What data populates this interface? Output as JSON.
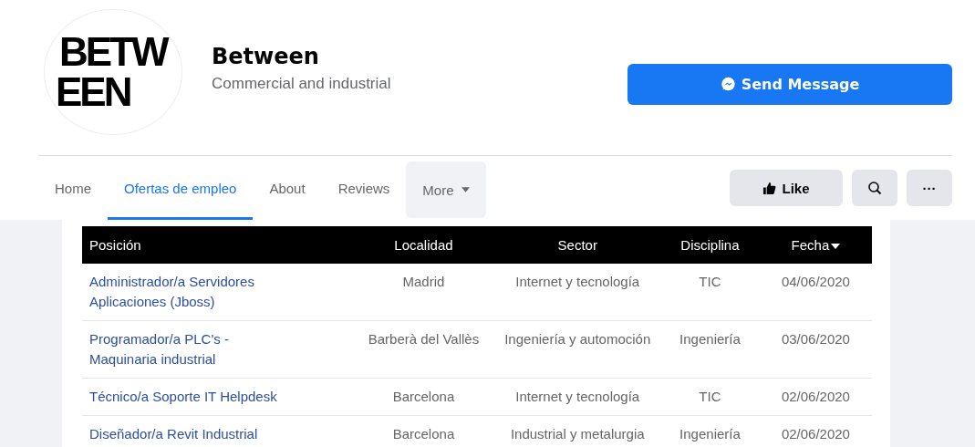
{
  "page": {
    "logo_lines": [
      "BETW",
      "EEN"
    ],
    "name": "Between",
    "category": "Commercial and industrial"
  },
  "send_button": {
    "label": "Send Message"
  },
  "tabs": [
    {
      "label": "Home",
      "selected": false,
      "kind": "tab"
    },
    {
      "label": "Ofertas de empleo",
      "selected": true,
      "kind": "tab"
    },
    {
      "label": "About",
      "selected": false,
      "kind": "tab"
    },
    {
      "label": "Reviews",
      "selected": false,
      "kind": "tab"
    },
    {
      "label": "More",
      "selected": false,
      "kind": "menu"
    }
  ],
  "actions": {
    "like": "Like",
    "more": "···"
  },
  "table": {
    "columns": [
      {
        "label": "Posición",
        "sorted": false
      },
      {
        "label": "Localidad",
        "sorted": false
      },
      {
        "label": "Sector",
        "sorted": false
      },
      {
        "label": "Disciplina",
        "sorted": false
      },
      {
        "label": "Fecha",
        "sorted": true
      }
    ],
    "rows": [
      [
        "Administrador/a Servidores Aplicaciones (Jboss)",
        "Madrid",
        "Internet y tecnología",
        "TIC",
        "04/06/2020"
      ],
      [
        "Programador/a PLC's - Maquinaria industrial",
        "Barberà del Vallès",
        "Ingeniería y automoción",
        "Ingeniería",
        "03/06/2020"
      ],
      [
        "Técnico/a Soporte IT Helpdesk",
        "Barcelona",
        "Internet y tecnología",
        "TIC",
        "02/06/2020"
      ],
      [
        "Diseñador/a Revit Industrial",
        "Barcelona",
        "Industrial y metalurgia",
        "Ingeniería",
        "02/06/2020"
      ]
    ]
  }
}
